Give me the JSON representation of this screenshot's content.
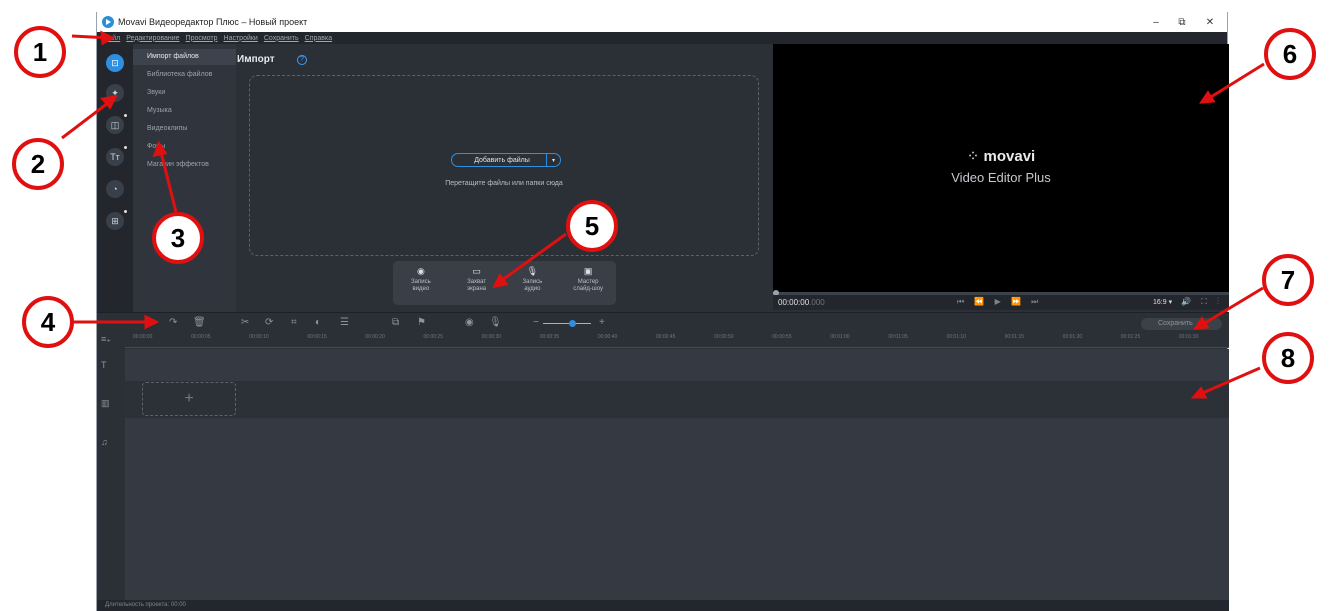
{
  "window": {
    "title": "Movavi Видеоредактор Плюс – Новый проект",
    "controls": {
      "minimize": "–",
      "maximize": "⧉",
      "close": "✕"
    }
  },
  "menu": [
    "Файл",
    "Редактирование",
    "Просмотр",
    "Настройки",
    "Сохранить",
    "Справка"
  ],
  "rail_icons": [
    "import-icon",
    "magic-wand-icon",
    "transitions-icon",
    "titles-icon",
    "filters-icon",
    "more-tools-icon"
  ],
  "categories": [
    {
      "label": "Импорт файлов",
      "selected": true
    },
    {
      "label": "Библиотека файлов",
      "selected": false
    },
    {
      "label": "Звуки",
      "selected": false
    },
    {
      "label": "Музыка",
      "selected": false
    },
    {
      "label": "Видеоклипы",
      "selected": false
    },
    {
      "label": "Фоны",
      "selected": false
    },
    {
      "label": "Магазин эффектов",
      "selected": false
    }
  ],
  "import": {
    "title": "Импорт",
    "help_icon": "?",
    "add_files": "Добавить файлы",
    "add_arrow": "▾",
    "drop_hint": "Перетащите файлы или папки сюда"
  },
  "capture": [
    {
      "icon": "◉",
      "line1": "Запись",
      "line2": "видео"
    },
    {
      "icon": "▭",
      "line1": "Захват",
      "line2": "экрана"
    },
    {
      "icon": "🎙",
      "line1": "Запись",
      "line2": "аудио"
    },
    {
      "icon": "▣",
      "line1": "Мастер",
      "line2": "слайд-шоу"
    }
  ],
  "preview": {
    "logo_mark": "⁘",
    "brand": "movavi",
    "product": "Video Editor Plus",
    "timecode": "00:00:00",
    "timecode_ms": ".000",
    "transport": "⏮ ⏪ ▶ ⏩ ⏭",
    "ratio": "16:9 ▾",
    "tools": "🔊 ⛶ ⋮"
  },
  "timeline_toolbar": {
    "undo": "↶",
    "redo": "↷",
    "delete": "🗑",
    "cut": "✂",
    "rotate": "⟳",
    "crop": "⌗",
    "color": "◐",
    "properties": "☰",
    "overlay": "⧉",
    "flag": "⚑",
    "record": "◉",
    "mic": "🎙",
    "zoom_out": "−",
    "zoom_in": "+",
    "zoom_level": 0.6,
    "save_label": "Сохранить"
  },
  "ruler": [
    "00:00:00",
    "00:00:05",
    "00:00:10",
    "00:00:15",
    "00:00:20",
    "00:00:25",
    "00:00:30",
    "00:00:35",
    "00:00:40",
    "00:00:45",
    "00:00:50",
    "00:00:55",
    "00:01:00",
    "00:01:05",
    "00:01:10",
    "00:01:15",
    "00:01:20",
    "00:01:25",
    "00:01:30"
  ],
  "tracks": {
    "text_icon": "T",
    "video_icon": "▥",
    "audio_icon": "♫",
    "add_clip": "+"
  },
  "status": "Длительность проекта: 00:00",
  "callouts": [
    "1",
    "2",
    "3",
    "4",
    "5",
    "6",
    "7",
    "8"
  ],
  "colors": {
    "accent": "#2e8fe0",
    "callout": "#e01010"
  }
}
